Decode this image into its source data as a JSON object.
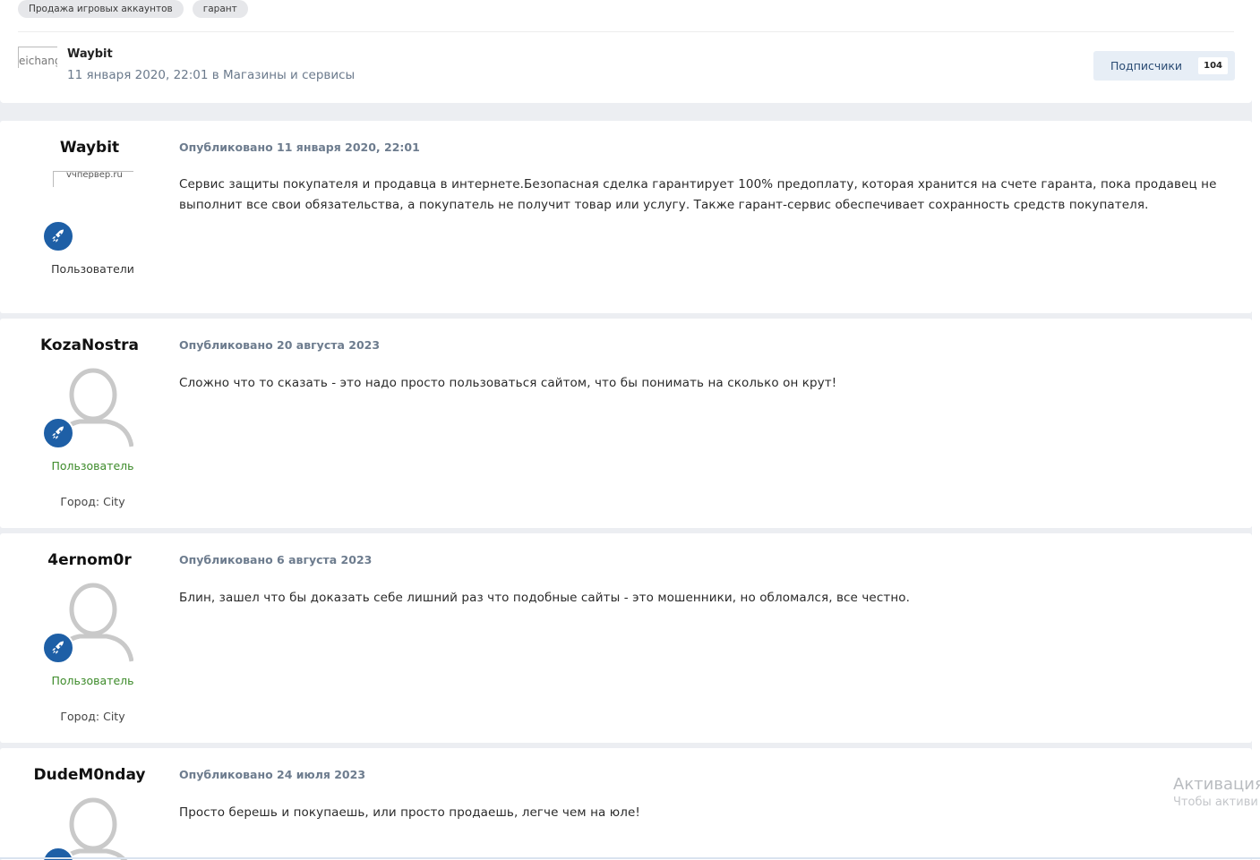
{
  "topic": {
    "tags": [
      "Продажа игровых аккаунтов",
      "гарант"
    ],
    "author_avatar_alt": "eichang",
    "author": "Waybit",
    "meta": "11 января 2020, 22:01 в Магазины и сервисы",
    "follow_label": "Подписчики",
    "follow_count": "104"
  },
  "posts": [
    {
      "author": "Waybit",
      "avatar_alt": "vчпервер.ru",
      "date": "Опубликовано 11 января 2020, 22:01",
      "body": "Сервис защиты покупателя и продавца в интернете.Безопасная сделка гарантирует 100% предоплату, которая хранится на счете гаранта, пока продавец не выполнит все свои обязательства, а покупатель не получит товар или услугу. Также гарант-сервис обеспечивает сохранность средств покупателя.",
      "group": "Пользователи"
    },
    {
      "author": "KozaNostra",
      "date": "Опубликовано 20 августа 2023",
      "body": "Сложно что то сказать - это надо просто пользоваться сайтом, что бы понимать на сколько он крут!",
      "group": "Пользователь",
      "city": "Город: City"
    },
    {
      "author": "4ernom0r",
      "date": "Опубликовано 6 августа 2023",
      "body": "Блин, зашел что бы доказать себе лишний раз что подобные сайты - это мошенники, но обломался, все честно.",
      "group": "Пользователь",
      "city": "Город: City"
    },
    {
      "author": "DudeM0nday",
      "date": "Опубликовано 24 июля 2023",
      "body": "Просто берешь и покупаешь, или просто продаешь, легче чем на юле!"
    }
  ],
  "watermark": {
    "title": "Активация",
    "subtitle": "Чтобы активи"
  },
  "colors": {
    "badge": "#1e5fa6",
    "group_green": "#3d8b2a",
    "meta_gray": "#6d7c8e"
  },
  "icons": [
    "rocket-icon",
    "default-avatar-icon"
  ]
}
